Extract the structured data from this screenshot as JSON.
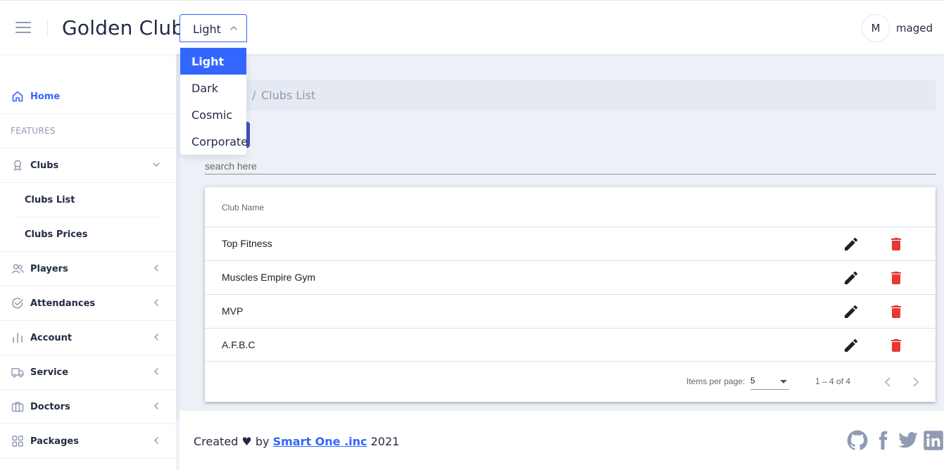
{
  "header": {
    "title": "Golden Club",
    "theme_value": "Light",
    "user_initial": "M",
    "user_name": "maged"
  },
  "theme_options": [
    "Light",
    "Dark",
    "Cosmic",
    "Corporate"
  ],
  "sidebar": {
    "home": "Home",
    "group_label": "FEATURES",
    "clubs": "Clubs",
    "clubs_list": "Clubs List",
    "clubs_prices": "Clubs Prices",
    "players": "Players",
    "attendances": "Attendances",
    "account": "Account",
    "service": "Service",
    "doctors": "Doctors",
    "packages": "Packages"
  },
  "breadcrumb": {
    "separator": "/",
    "current": "Clubs List"
  },
  "search": {
    "placeholder": "search here"
  },
  "table": {
    "header": "Club Name",
    "rows": [
      "Top Fitness",
      "Muscles Empire Gym",
      "MVP",
      "A.F.B.C"
    ]
  },
  "paginator": {
    "items_per_page_label": "Items per page:",
    "items_per_page": "5",
    "range": "1 – 4 of 4"
  },
  "footer": {
    "prefix": "Created ♥ by",
    "company": "Smart One .inc",
    "year": "2021"
  },
  "colors": {
    "accent": "#3366ff",
    "delete": "#e53935",
    "add_button": "#3f51b5"
  },
  "icons": {
    "menu": "hamburger-icon",
    "home": "home-icon",
    "clubs": "award-icon",
    "players": "people-icon",
    "attendances": "checkmark-circle-icon",
    "account": "bar-chart-icon",
    "service": "car-icon",
    "doctors": "briefcase-icon",
    "packages": "grid-icon",
    "edit": "pencil-icon",
    "delete": "trash-icon",
    "social": [
      "github-icon",
      "facebook-icon",
      "twitter-icon",
      "linkedin-icon"
    ]
  }
}
